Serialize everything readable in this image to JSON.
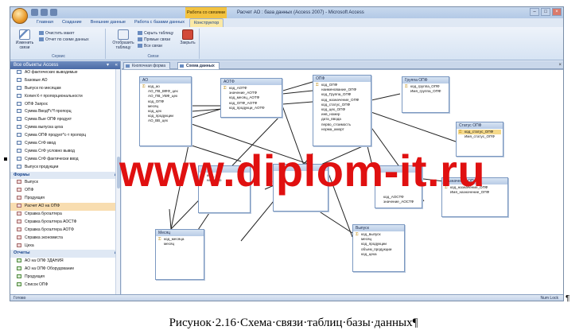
{
  "window": {
    "title": "Расчет АО : база данных (Access 2007) - Microsoft Access",
    "context_tab": "Работа со связями"
  },
  "tabs": [
    "Главная",
    "Создание",
    "Внешние данные",
    "Работа с базами данных",
    "Конструктор"
  ],
  "ribbon": {
    "edit_links": "Изменить связи",
    "clear_layout": "Очистить макет",
    "relationship_report": "Отчет по схеме данных",
    "group_service": "Сервис",
    "show_table": "Отобразить таблицу",
    "hide_table": "Скрыть таблицу",
    "direct_links": "Прямые связи",
    "all_links": "Все связи",
    "close": "Закрыть",
    "group_links": "Связи"
  },
  "nav": {
    "header": "Все объекты Access",
    "queries": [
      "АО фактических выводимые",
      "Базовые АО",
      "Выпуск по месяцам",
      "Копия К-т пропорциональности",
      "ОПФ Запрос",
      "Сумма Вводf*с*f пропорц",
      "Сумма Вые ОПФ продукт",
      "Сумма выпуска цеха",
      "Сумма ОПФ продукт*с-т пропорц",
      "Сумма СтФ ввод",
      "Сумма СтФ условно вывод",
      "Сумма СтФ фактически ввод",
      "Выпуск продукции"
    ],
    "forms_label": "Формы",
    "forms": [
      "Выпуск",
      "ОПФ",
      "Продукция",
      "Расчет АО на ОПФ",
      "Справка бухгалтера",
      "Справка бухгалтера АОСТФ",
      "Справка бухгалтера АОТФ",
      "Справка экономиста",
      "Цеха"
    ],
    "reports_label": "Отчеты",
    "reports": [
      "АО на ОПФ ЗДАНИЯ",
      "АО на ОПФ Оборудование",
      "Продукция",
      "Список ОПФ"
    ]
  },
  "doc_tabs": [
    "Кнопочная форма",
    "Схема данных"
  ],
  "tables": {
    "ao": {
      "name": "АО",
      "fields": [
        "код_ао",
        "АО_ПВ_ВФФ_цех",
        "АО_ПВ_УВФ_цех",
        "код_ОПФ",
        "месяц",
        "код_цех",
        "код_продукции",
        "АО_ВВ_цех"
      ]
    },
    "aotf": {
      "name": "АОТФ",
      "fields": [
        "код_АОТФ",
        "значение_АОТФ",
        "код_месяц_АОТФ",
        "код_ОПФ_АОТФ",
        "код_продукци_АОТФ"
      ]
    },
    "opf": {
      "name": "ОПФ",
      "fields": [
        "код_ОПФ",
        "наименование_ОПФ",
        "код_Группа_ОПФ",
        "код_назначение_ОПФ",
        "код_статус_ОПФ",
        "код_цех_ОПФ",
        "инв_номер",
        "дата_ввода",
        "перво_стоимость",
        "норма_аморт"
      ]
    },
    "gruppa": {
      "name": "Группа ОПФ",
      "fields": [
        "код_группа_ОПФ",
        "Имя_группа_ОПФ"
      ]
    },
    "status": {
      "name": "Статус ОПФ",
      "fields": [
        "код_статус_ОПФ",
        "Имя_статус_ОПФ"
      ]
    },
    "naznach": {
      "name": "Назначение ОПФ",
      "fields": [
        "код_назначение_ОПФ",
        "Имя_назначение_ОПФ"
      ]
    },
    "mid": {
      "name": "",
      "fields": [
        "код_АОСТФ",
        "значение_АОСТФ"
      ]
    },
    "tseh": {
      "name": "",
      "fields": [
        "код_",
        "наимено"
      ]
    },
    "mesyac": {
      "name": "Месяц",
      "fields": [
        "код_месяца",
        "месяц"
      ]
    },
    "vypusk": {
      "name": "Выпуск",
      "fields": [
        "код_выпуск",
        "месяц",
        "код_продукции",
        "объем_продукции",
        "код_цеха"
      ]
    }
  },
  "watermark": "www.diplom-it.ru",
  "status": {
    "left": "Готово",
    "right": "Num Lock"
  },
  "caption": "Рисунок·2.16·Схема·связи·таблиц·базы·данных¶",
  "pilcrow": "¶",
  "colors": {
    "watermark": "#e01010",
    "ribbon": "#dfe8f4",
    "context_tab": "#f3c23f"
  }
}
